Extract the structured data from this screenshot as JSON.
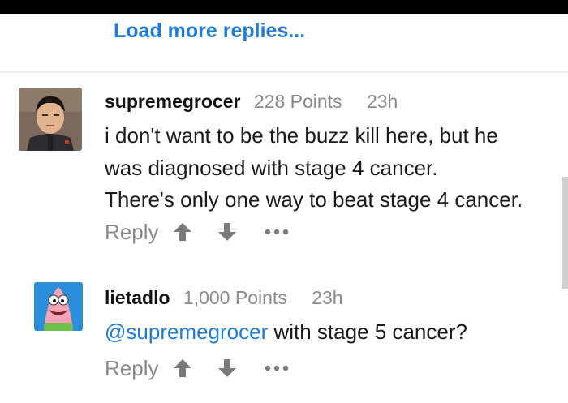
{
  "thread": {
    "load_more_label": "Load more replies..."
  },
  "comments": [
    {
      "username": "supremegrocer",
      "points": "228 Points",
      "time": "23h",
      "lines": [
        "i don't want to be the buzz kill here, but he",
        "was diagnosed with stage 4 cancer.",
        "There's only one way to beat stage 4 cancer."
      ],
      "reply_label": "Reply"
    },
    {
      "username": "lietadlo",
      "points": "1,000 Points",
      "time": "23h",
      "mention": "@supremegrocer",
      "text": " with stage 5 cancer?",
      "reply_label": "Reply"
    }
  ],
  "icons": {
    "upvote": "arrow-up-icon",
    "downvote": "arrow-down-icon",
    "more": "more-options-icon"
  },
  "colors": {
    "link": "#1f7bd8",
    "muted": "#8a8a8a",
    "icon": "#7a7a7a"
  }
}
